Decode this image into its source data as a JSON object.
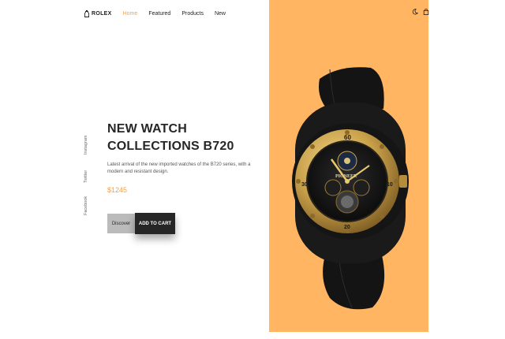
{
  "brand": {
    "name": "ROLEX",
    "logo_icon": "bottle-icon"
  },
  "nav": {
    "links": [
      "Home",
      "Featured",
      "Products",
      "New"
    ],
    "active": "Home"
  },
  "nav_actions": {
    "theme_icon": "moon-icon",
    "bag_icon": "shopping-bag-icon"
  },
  "social": [
    "Instagram",
    "Twitter",
    "Facebook"
  ],
  "hero": {
    "title_line1": "NEW WATCH",
    "title_line2": "COLLECTIONS B720",
    "description": "Latest arrival of the new imported watches of the B720 series, with a modern and resistant design.",
    "price": "$1245",
    "discover_label": "Discover",
    "cart_label": "ADD TO CART"
  },
  "colors": {
    "accent": "#f5a14a",
    "panel": "#ffb561",
    "dark": "#262626",
    "button_gray": "#bbbbbb"
  },
  "watch": {
    "bezel_numbers": [
      "60",
      "10",
      "20",
      "30"
    ],
    "dial_text": "PIONEER"
  }
}
